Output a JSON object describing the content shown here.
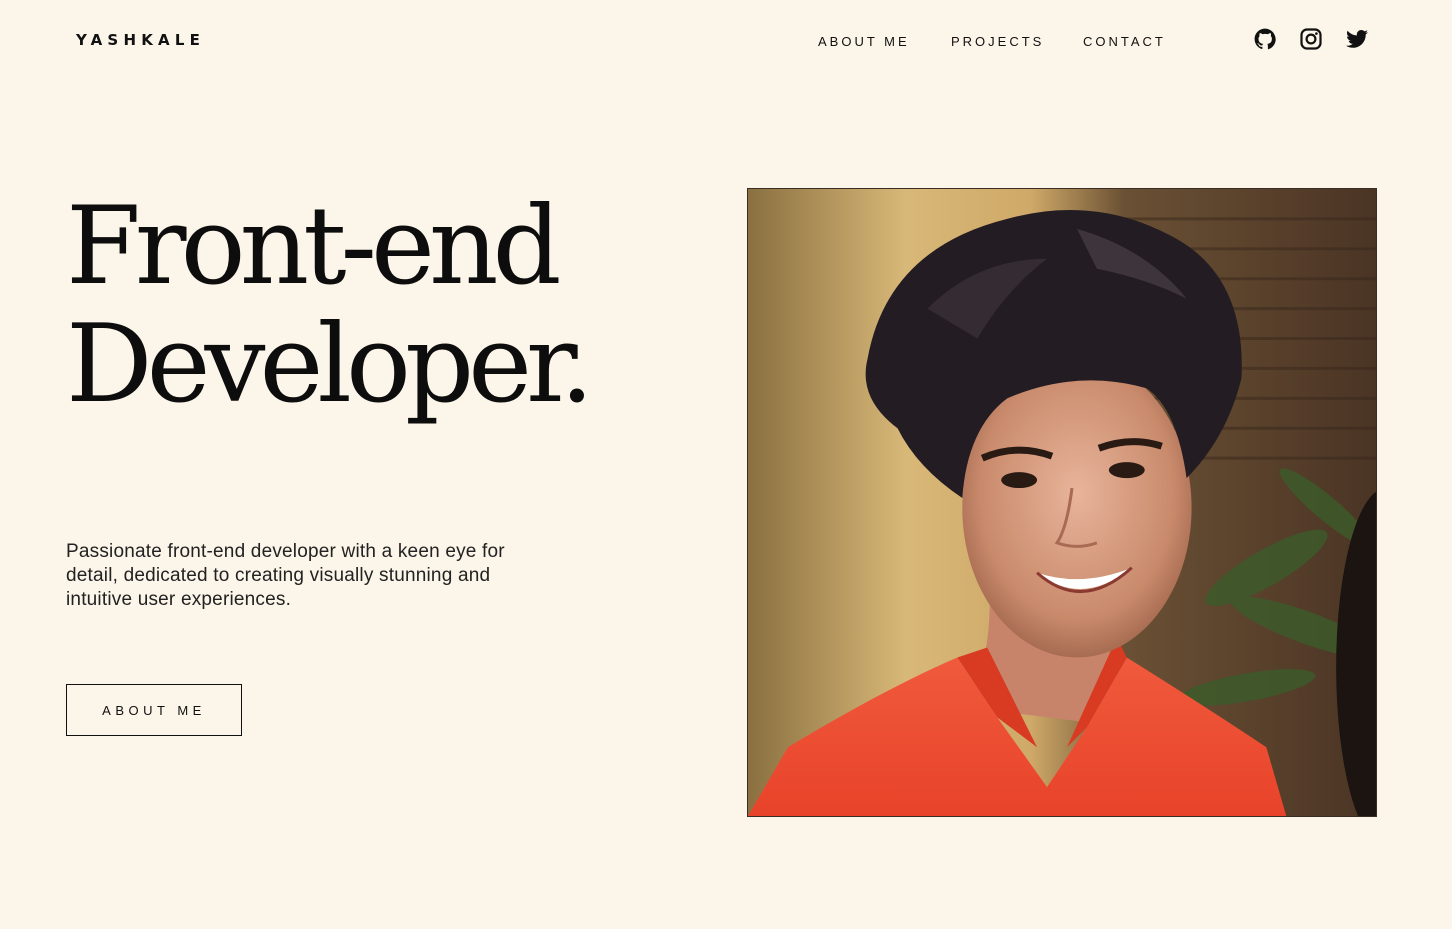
{
  "brand": {
    "logo_text": "YASHKALE"
  },
  "nav": {
    "items": [
      {
        "label": "ABOUT ME"
      },
      {
        "label": "PROJECTS"
      },
      {
        "label": "CONTACT"
      }
    ]
  },
  "social": {
    "icons": [
      "github-icon",
      "instagram-icon",
      "twitter-icon"
    ]
  },
  "hero": {
    "headline_line1": "Front-end",
    "headline_line2": "Developer.",
    "tagline": "Passionate front-end developer with a keen eye for detail, dedicated to creating visually stunning and intuitive user experiences.",
    "cta_label": "ABOUT ME"
  },
  "colors": {
    "background": "#fcf5e9",
    "text": "#111111",
    "shirt": "#ef4a2f"
  }
}
